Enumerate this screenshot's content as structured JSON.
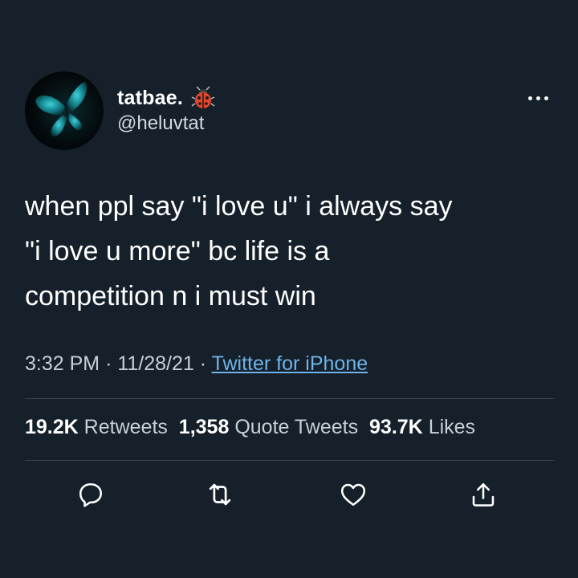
{
  "user": {
    "display_name": "tatbae.",
    "handle": "@heluvtat",
    "name_emoji": "ladybug-emoji",
    "avatar": "butterfly-avatar"
  },
  "tweet": {
    "lines": [
      "when ppl say \"i love u\" i always say",
      "\"i love u more\" bc life is a",
      "competition n i must win"
    ]
  },
  "meta": {
    "time": "3:32 PM",
    "separator": "·",
    "date": "11/28/21",
    "source": "Twitter for iPhone"
  },
  "stats": {
    "retweets_count": "19.2K",
    "retweets_label": "Retweets",
    "quotes_count": "1,358",
    "quotes_label": "Quote Tweets",
    "likes_count": "93.7K",
    "likes_label": "Likes"
  },
  "actions": {
    "icons": [
      "reply-icon",
      "retweet-icon",
      "like-icon",
      "share-icon"
    ]
  },
  "colors": {
    "background": "#15202b",
    "text": "#ffffff",
    "secondary_text": "#c8cfd4",
    "link": "#6fb3e8",
    "divider": "#38444d"
  }
}
